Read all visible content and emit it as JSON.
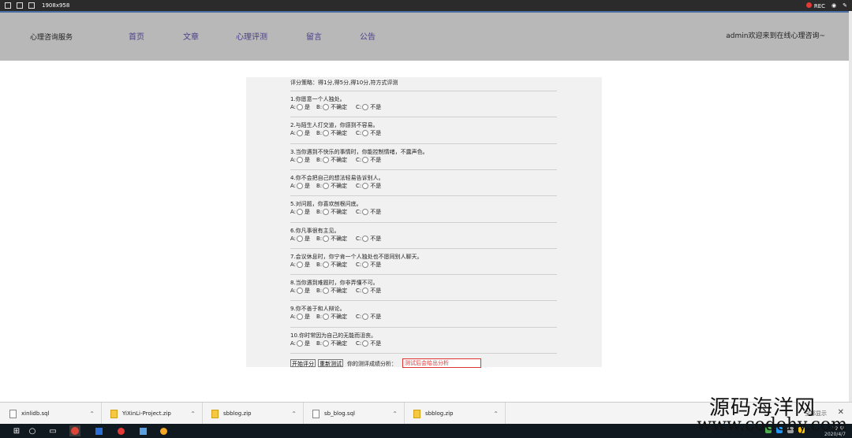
{
  "recorder": {
    "size_label": "1908x958",
    "rec_label": "REC"
  },
  "header": {
    "brand": "心理咨询服务",
    "nav": [
      "首页",
      "文章",
      "心理评测",
      "留言",
      "公告"
    ],
    "welcome": "admin欢迎来到在线心理咨询~"
  },
  "quiz": {
    "policy": "评分策略：得1分,得5分,得10分,符方式评测",
    "options": {
      "a": "A:",
      "a_text": "是",
      "b": "B:",
      "b_text": "不确定",
      "c": "C:",
      "c_text": "不是"
    },
    "questions": [
      "1.你愿意一个人独处。",
      "2.与陌生人打交道，你感到不容易。",
      "3.当你遇到不快乐的事情时，你能控制情绪，不露声色。",
      "4.你不会把自己的想法轻易告诉别人。",
      "5.对问题，你喜欢刨根问底。",
      "6.你凡事很有主见。",
      "7.会议休息时，你宁肯一个人独处也不愿同别人聊天。",
      "8.当你遇到难题时，你非弄懂不可。",
      "9.你不善于和人辩论。",
      "10.你时常因为自己的无能而沮丧。"
    ],
    "start_button": "开始评分",
    "retest_button": "重新测试",
    "result_label": "你的测评成绩分析：",
    "result_value": "测试后会给出分析"
  },
  "downloads": [
    {
      "name": "xinlidb.sql",
      "type": "sql"
    },
    {
      "name": "YiXinLi-Project.zip",
      "type": "zip"
    },
    {
      "name": "sbblog.zip",
      "type": "zip"
    },
    {
      "name": "sb_blog.sql",
      "type": "sql"
    },
    {
      "name": "sbblog.zip",
      "type": "zip"
    }
  ],
  "download_bar": {
    "show_all": "全部显示",
    "close": "✕"
  },
  "taskbar": {
    "time": "22:55",
    "date": "2020/4/7"
  },
  "watermark": {
    "line1": "源码海洋网",
    "line2": "www.codehy.com"
  }
}
